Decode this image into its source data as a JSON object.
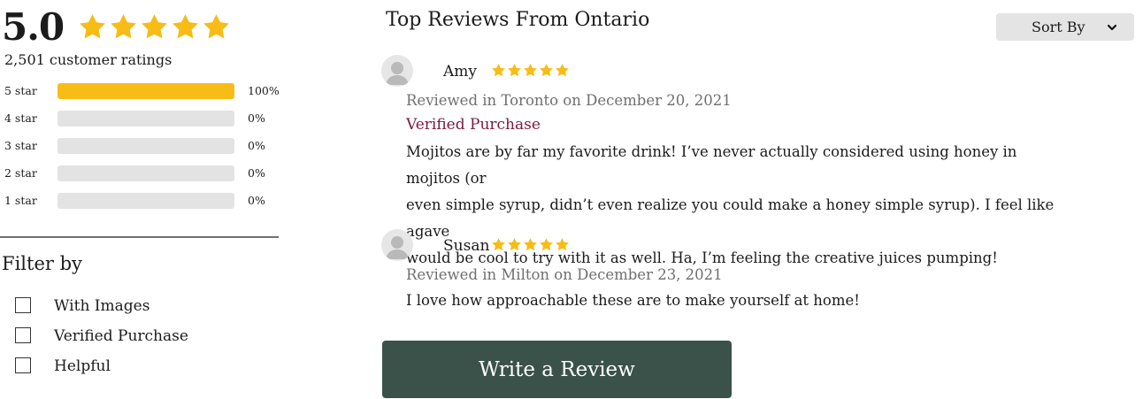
{
  "summary": {
    "average": "5.0",
    "stars_filled": 5,
    "count_text": "2,501 customer ratings",
    "star_color": "#f7bc15"
  },
  "histogram": [
    {
      "label": "5 star",
      "percent_text": "100%",
      "fill": 1.0
    },
    {
      "label": "4 star",
      "percent_text": "0%",
      "fill": 0.0
    },
    {
      "label": "3 star",
      "percent_text": "0%",
      "fill": 0.0
    },
    {
      "label": "2 star",
      "percent_text": "0%",
      "fill": 0.0
    },
    {
      "label": "1 star",
      "percent_text": "0%",
      "fill": 0.0
    }
  ],
  "filter": {
    "title": "Filter by",
    "options": [
      {
        "label": "With Images",
        "checked": false
      },
      {
        "label": "Verified Purchase",
        "checked": false
      },
      {
        "label": "Helpful",
        "checked": false
      }
    ]
  },
  "reviews_header": {
    "title": "Top Reviews From Ontario",
    "sort_label": "Sort By",
    "sort_icon": "chevron-down-icon"
  },
  "reviews": [
    {
      "name": "Amy",
      "stars": 5,
      "meta": "Reviewed in Toronto on December 20, 2021",
      "verified": "Verified Purchase",
      "body_lines": [
        "Mojitos are by far my favorite drink! I’ve never actually considered using honey in mojitos (or",
        "even simple syrup, didn’t even realize you could make a honey simple syrup). I feel like agave",
        "would be cool to try with it as well. Ha, I’m feeling the creative juices pumping!"
      ]
    },
    {
      "name": "Susan",
      "stars": 5,
      "meta": "Reviewed in Milton on December 23, 2021",
      "body_lines": [
        "I love how approachable these are to make yourself at home!"
      ]
    }
  ],
  "write_review_label": "Write a Review",
  "colors": {
    "accent_button": "#3a5249",
    "verified_text": "#7a1b3a",
    "star": "#f7bc15",
    "bar_empty": "#e3e3e3"
  }
}
